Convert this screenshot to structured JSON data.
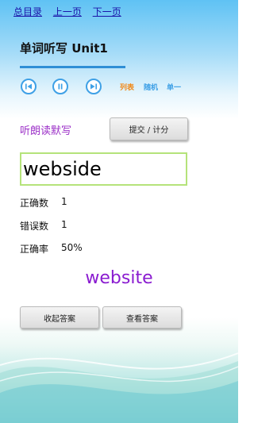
{
  "nav": {
    "home": "总目录",
    "prev": "上一页",
    "next": "下一页"
  },
  "title": "单词听写 Unit1",
  "controls": {
    "prev_icon": "skip-previous-icon",
    "pause_icon": "pause-icon",
    "next_icon": "skip-next-icon",
    "modes": {
      "list": "列表",
      "random": "随机",
      "single": "单一"
    },
    "colors": {
      "accent": "#3ea0e6",
      "list_mode": "#f08a1c"
    }
  },
  "dictation": {
    "label": "听朗读默写",
    "submit_label": "提交 / 计分",
    "input_value": "webside"
  },
  "stats": {
    "correct_label": "正确数",
    "correct_value": "1",
    "wrong_label": "错误数",
    "wrong_value": "1",
    "rate_label": "正确率",
    "rate_value": "50%"
  },
  "answer": {
    "word": "website",
    "collapse_label": "收起答案",
    "view_label": "查看答案"
  }
}
